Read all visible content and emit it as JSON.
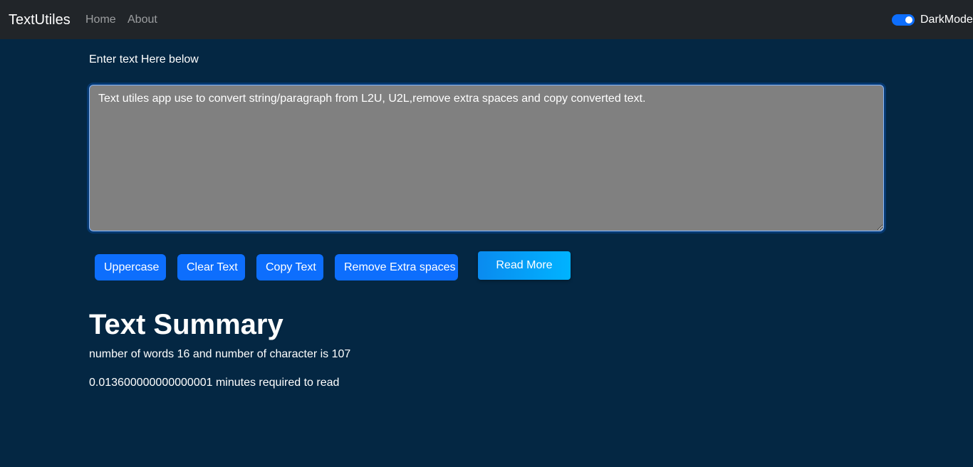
{
  "navbar": {
    "brand": "TextUtiles",
    "links": [
      {
        "label": "Home"
      },
      {
        "label": "About"
      }
    ],
    "dark_mode_label": "DarkMode",
    "dark_mode_on": true
  },
  "form": {
    "prompt": "Enter text Here below",
    "textarea_value": "Text utiles app use to convert string/paragraph from L2U, U2L,remove extra spaces and copy converted text."
  },
  "buttons": {
    "uppercase": "Uppercase",
    "clear": "Clear Text",
    "copy": "Copy Text",
    "remove_spaces": "Remove Extra spaces",
    "read_more": "Read More"
  },
  "summary": {
    "title": "Text Summary",
    "counts_line": "number of words 16 and number of character is 107",
    "time_line": "0.013600000000000001 minutes required to read"
  },
  "colors": {
    "background": "#042743",
    "navbar": "#212529",
    "button": "#0d6efd",
    "textarea_bg": "#808080"
  }
}
